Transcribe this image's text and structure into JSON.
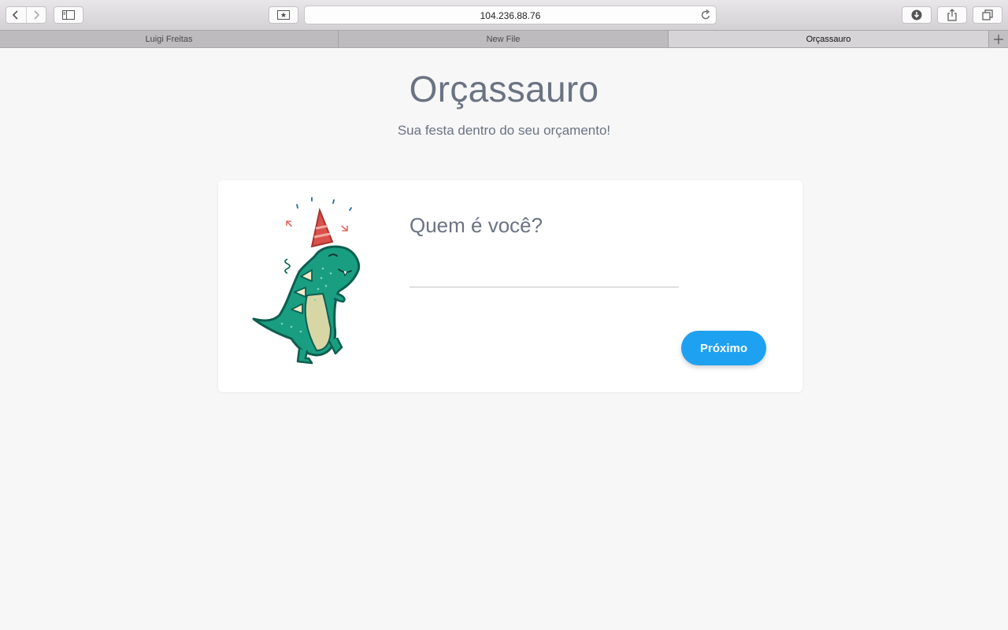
{
  "browser": {
    "url": "104.236.88.76",
    "tabs": [
      {
        "label": "Luigi Freitas",
        "active": false
      },
      {
        "label": "New File",
        "active": false
      },
      {
        "label": "Orçassauro",
        "active": true
      }
    ],
    "icons": [
      "back-icon",
      "forward-icon",
      "sidebar-icon",
      "bookmark-star-icon",
      "reload-icon",
      "download-icon",
      "share-icon",
      "tabs-overview-icon",
      "new-tab-icon"
    ]
  },
  "page": {
    "title": "Orçassauro",
    "subtitle": "Sua festa dentro do seu orçamento!"
  },
  "form": {
    "question": "Quem é você?",
    "input_value": "",
    "next_label": "Próximo"
  },
  "colors": {
    "accent": "#1fa1f2",
    "title_text": "#6b7383",
    "dino_green": "#1a9e82",
    "party_hat": "#d9514a",
    "background": "#f7f7f7"
  }
}
